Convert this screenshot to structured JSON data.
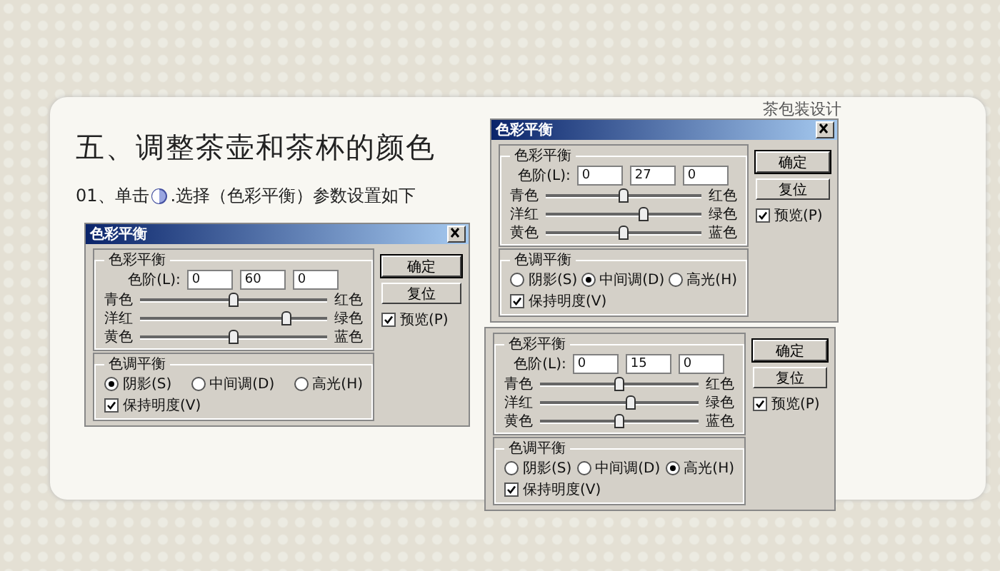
{
  "heading": "五、调整茶壶和茶杯的颜色",
  "step": {
    "before": "01、单击",
    "after": ".选择（色彩平衡）参数设置如下"
  },
  "corner_title": "茶包装设计",
  "dialogs": [
    {
      "title": "色彩平衡",
      "balance_group": "色彩平衡",
      "levels_label": "色阶(L):",
      "values": [
        "0",
        "60",
        "0"
      ],
      "sliders": [
        {
          "left": "青色",
          "right": "红色",
          "level": 0.5
        },
        {
          "left": "洋红",
          "right": "绿色",
          "level": 0.8
        },
        {
          "left": "黄色",
          "right": "蓝色",
          "level": 0.5
        }
      ],
      "tone_group": "色调平衡",
      "tones": [
        {
          "label": "阴影(S)",
          "selected": true
        },
        {
          "label": "中间调(D)",
          "selected": false
        },
        {
          "label": "高光(H)",
          "selected": false
        }
      ],
      "preserve": {
        "label": "保持明度(V)",
        "checked": true
      },
      "ok": "确定",
      "reset": "复位",
      "preview": {
        "label": "预览(P)",
        "checked": true
      }
    },
    {
      "title": "色彩平衡",
      "balance_group": "色彩平衡",
      "levels_label": "色阶(L):",
      "values": [
        "0",
        "27",
        "0"
      ],
      "sliders": [
        {
          "left": "青色",
          "right": "红色",
          "level": 0.5
        },
        {
          "left": "洋红",
          "right": "绿色",
          "level": 0.635
        },
        {
          "left": "黄色",
          "right": "蓝色",
          "level": 0.5
        }
      ],
      "tone_group": "色调平衡",
      "tones": [
        {
          "label": "阴影(S)",
          "selected": false
        },
        {
          "label": "中间调(D)",
          "selected": true
        },
        {
          "label": "高光(H)",
          "selected": false
        }
      ],
      "preserve": {
        "label": "保持明度(V)",
        "checked": true
      },
      "ok": "确定",
      "reset": "复位",
      "preview": {
        "label": "预览(P)",
        "checked": true
      }
    },
    {
      "balance_group": "色彩平衡",
      "levels_label": "色阶(L):",
      "values": [
        "0",
        "15",
        "0"
      ],
      "sliders": [
        {
          "left": "青色",
          "right": "红色",
          "level": 0.5
        },
        {
          "left": "洋红",
          "right": "绿色",
          "level": 0.575
        },
        {
          "left": "黄色",
          "right": "蓝色",
          "level": 0.5
        }
      ],
      "tone_group": "色调平衡",
      "tones": [
        {
          "label": "阴影(S)",
          "selected": false
        },
        {
          "label": "中间调(D)",
          "selected": false
        },
        {
          "label": "高光(H)",
          "selected": true
        }
      ],
      "preserve": {
        "label": "保持明度(V)",
        "checked": true
      },
      "ok": "确定",
      "reset": "复位",
      "preview": {
        "label": "预览(P)",
        "checked": true
      }
    }
  ]
}
